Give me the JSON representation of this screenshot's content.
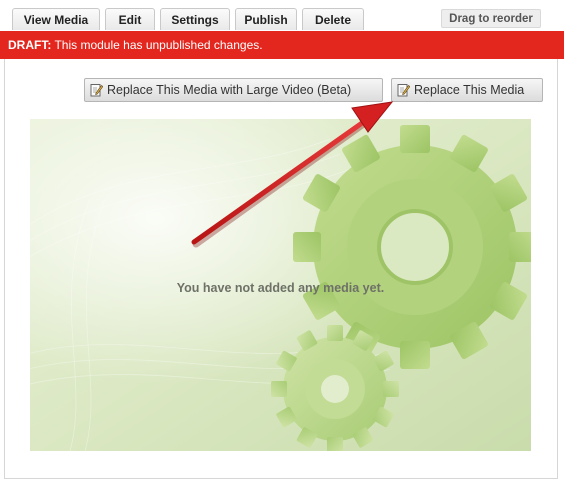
{
  "tabs": [
    {
      "label": "View Media"
    },
    {
      "label": "Edit"
    },
    {
      "label": "Settings"
    },
    {
      "label": "Publish"
    },
    {
      "label": "Delete"
    }
  ],
  "reorder_label": "Drag to reorder",
  "draft": {
    "prefix": "DRAFT:",
    "message": " This module has unpublished changes."
  },
  "buttons": {
    "replace_large_video": "Replace This Media with Large Video (Beta)",
    "replace_media": "Replace This Media"
  },
  "media": {
    "empty_message": "You have not added any media yet."
  },
  "colors": {
    "draft_bar": "#e3261e",
    "arrow": "#d42020",
    "media_bg": "#dde9c6"
  },
  "icons": {
    "button_icon": "edit-note-icon",
    "decoration": "gear-icon"
  }
}
